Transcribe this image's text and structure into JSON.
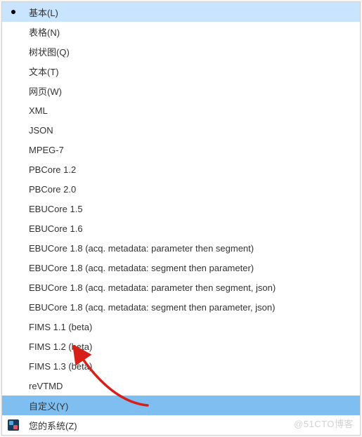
{
  "menu": {
    "items": [
      {
        "label": "基本(L)",
        "state": "active-light",
        "icon": "bullet"
      },
      {
        "label": "表格(N)"
      },
      {
        "label": "树状图(Q)"
      },
      {
        "label": "文本(T)"
      },
      {
        "label": "网页(W)"
      },
      {
        "label": "XML"
      },
      {
        "label": "JSON"
      },
      {
        "label": "MPEG-7"
      },
      {
        "label": "PBCore 1.2"
      },
      {
        "label": "PBCore 2.0"
      },
      {
        "label": "EBUCore 1.5"
      },
      {
        "label": "EBUCore 1.6"
      },
      {
        "label": "EBUCore 1.8 (acq. metadata: parameter then segment)"
      },
      {
        "label": "EBUCore 1.8 (acq. metadata: segment then parameter)"
      },
      {
        "label": "EBUCore 1.8 (acq. metadata: parameter then segment, json)"
      },
      {
        "label": "EBUCore 1.8 (acq. metadata: segment then parameter, json)"
      },
      {
        "label": "FIMS 1.1 (beta)"
      },
      {
        "label": "FIMS 1.2 (beta)"
      },
      {
        "label": "FIMS 1.3 (beta)"
      },
      {
        "label": "reVTMD"
      },
      {
        "label": "自定义(Y)",
        "state": "selected"
      },
      {
        "label": "您的系统(Z)",
        "icon": "system"
      }
    ]
  },
  "arrow": {
    "color": "#d8201a"
  },
  "watermark": "@51CTO博客"
}
